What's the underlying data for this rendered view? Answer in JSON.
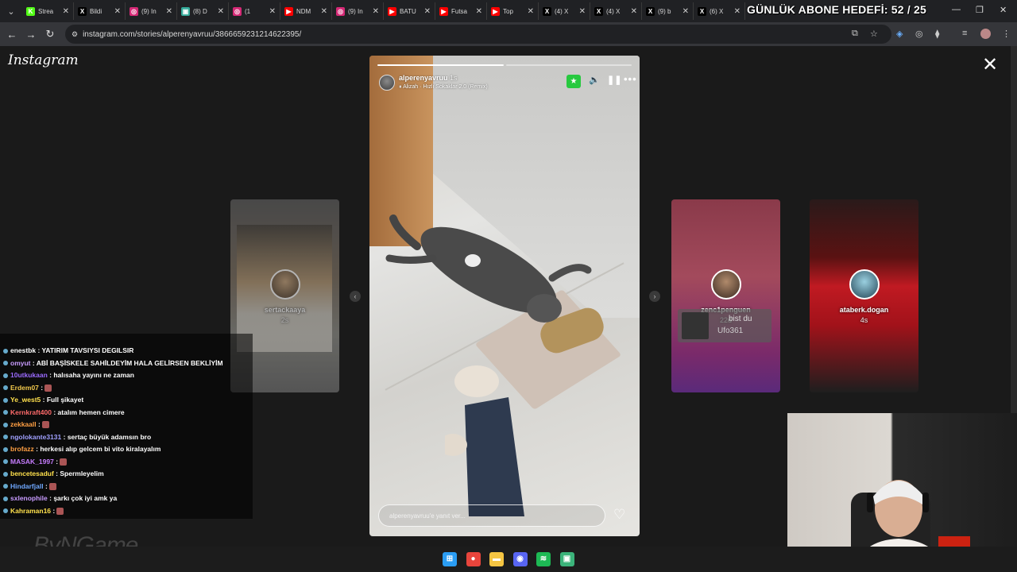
{
  "browser": {
    "goal_text": "GÜNLÜK ABONE HEDEFİ: 52 / 25",
    "tabs": [
      {
        "label": "Strea",
        "color": "#53fc18",
        "glyph": "K"
      },
      {
        "label": "Bildi",
        "color": "#000000",
        "glyph": "X"
      },
      {
        "label": "(9) In",
        "color": "#d62976",
        "glyph": "◎"
      },
      {
        "label": "(8) D",
        "color": "#3a9",
        "glyph": "▣"
      },
      {
        "label": "(1",
        "color": "#d62976",
        "glyph": "◎"
      },
      {
        "label": "NDM",
        "color": "#ff0000",
        "glyph": "▶"
      },
      {
        "label": "(9) In",
        "color": "#d62976",
        "glyph": "◎"
      },
      {
        "label": "BATU",
        "color": "#ff0000",
        "glyph": "▶"
      },
      {
        "label": "Futsa",
        "color": "#ff0000",
        "glyph": "▶"
      },
      {
        "label": "Top",
        "color": "#ff0000",
        "glyph": "▶"
      },
      {
        "label": "(4) X",
        "color": "#000000",
        "glyph": "X"
      },
      {
        "label": "(4) X",
        "color": "#000000",
        "glyph": "X"
      },
      {
        "label": "(9) b",
        "color": "#000000",
        "glyph": "X"
      },
      {
        "label": "(6) X",
        "color": "#000000",
        "glyph": "X"
      }
    ],
    "url": "instagram.com/stories/alperenyavruu/3866659231214622395/"
  },
  "instagram": {
    "logo": "Instagram",
    "story": {
      "username": "alperenyavruu",
      "time": "1s",
      "music": "Alizah · Hızlı Sokaklar 2.0 (Remix)",
      "reply_placeholder": "alperenyavruu'e yanıt ver...",
      "progress_done_fraction": 0.5
    },
    "cards": [
      {
        "user": "sertackaaya",
        "time": "2s"
      },
      {
        "user": "zenc1penguen",
        "time": "22d"
      },
      {
        "user": "ataberk.dogan",
        "time": "4s"
      }
    ],
    "card_overlay_texts": [
      "bist du",
      "Ufo361"
    ]
  },
  "chat": [
    {
      "user": "enestbk",
      "color": "#ffffff",
      "msg": ": YATIRIM TAVSIYSI DEGILSIR"
    },
    {
      "user": "omyut",
      "color": "#c89bff",
      "msg": ": ABİ BAŞİSKELE SAHİLDEYİM HALA GELİRSEN BEKLİYİM"
    },
    {
      "user": "10utkukaan",
      "color": "#9b6bff",
      "msg": ": halısaha yayını ne zaman"
    },
    {
      "user": "Erdem07",
      "color": "#f2c94c",
      "msg": ":"
    },
    {
      "user": "Ye_west5",
      "color": "#ffe14d",
      "msg": ": Full şikayet"
    },
    {
      "user": "Kernkraft400",
      "color": "#ff6b6b",
      "msg": ": atalım hemen cimere"
    },
    {
      "user": "zekkaall",
      "color": "#ff9f43",
      "msg": ":"
    },
    {
      "user": "ngolokante3131",
      "color": "#a0a0ff",
      "msg": ": sertaç büyük adamsın bro"
    },
    {
      "user": "brofazz",
      "color": "#ff9f43",
      "msg": ": herkesi alıp gelcem bi vito kiralayalım"
    },
    {
      "user": "MASAK_1997",
      "color": "#c77dff",
      "msg": ":"
    },
    {
      "user": "bencetesaduf",
      "color": "#ffe14d",
      "msg": ": Spermleyelim"
    },
    {
      "user": "Hindarfjall",
      "color": "#6fa8ff",
      "msg": ":"
    },
    {
      "user": "sxlenophile",
      "color": "#c89bff",
      "msg": ": şarkı çok iyi amk ya"
    },
    {
      "user": "Kahraman16",
      "color": "#ffe14d",
      "msg": ":"
    }
  ],
  "overlay_logo": "ByNGame",
  "taskbar": [
    {
      "name": "windows-start",
      "color": "#2a9df4",
      "glyph": "⊞"
    },
    {
      "name": "chrome",
      "color": "#e8453c",
      "glyph": "●"
    },
    {
      "name": "file-explorer",
      "color": "#f5c542",
      "glyph": "▬"
    },
    {
      "name": "discord",
      "color": "#5865f2",
      "glyph": "◉"
    },
    {
      "name": "spotify",
      "color": "#1db954",
      "glyph": "≋"
    },
    {
      "name": "app",
      "color": "#3bb37a",
      "glyph": "▣"
    }
  ]
}
